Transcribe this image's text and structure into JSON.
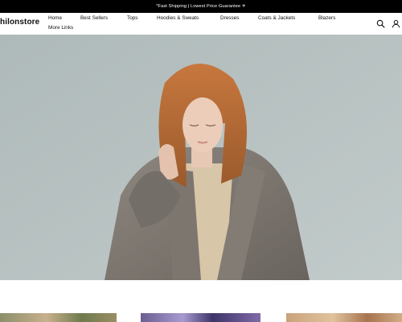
{
  "announcement": {
    "text": "*Fast Shipping | Lowest Price Guarantee ✈"
  },
  "header": {
    "logo": "hilonstore",
    "nav": [
      {
        "label": "Home"
      },
      {
        "label": "Best Sellers"
      },
      {
        "label": "Tops"
      },
      {
        "label": "Hoodies & Sweats"
      },
      {
        "label": "Dresses"
      },
      {
        "label": "Coats & Jackets"
      },
      {
        "label": "Blazers"
      },
      {
        "label": "More Links"
      }
    ],
    "icons": {
      "search": "search-icon",
      "account": "user-icon"
    }
  },
  "hero": {
    "image": "woman-in-grey-wool-coat-photo"
  },
  "products": [
    {
      "image": "product-thumbnail-1"
    },
    {
      "image": "product-thumbnail-2"
    },
    {
      "image": "product-thumbnail-3"
    }
  ]
}
